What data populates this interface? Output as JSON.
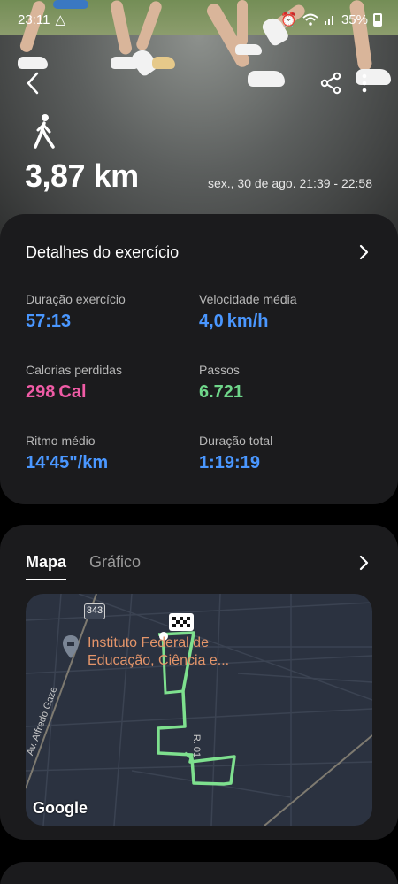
{
  "status_bar": {
    "time": "23:11",
    "battery": "35%"
  },
  "header": {
    "distance": "3,87 km",
    "date_range": "sex., 30 de ago. 21:39 - 22:58"
  },
  "details": {
    "title": "Detalhes do exercício",
    "stats": [
      {
        "label": "Duração exercício",
        "value": "57:13"
      },
      {
        "label": "Velocidade média",
        "value": "4,0 km/h"
      },
      {
        "label": "Calorias perdidas",
        "value": "298 Cal"
      },
      {
        "label": "Passos",
        "value": "6.721"
      },
      {
        "label": "Ritmo médio",
        "value": "14'45\"/km"
      },
      {
        "label": "Duração total",
        "value": "1:19:19"
      }
    ]
  },
  "map_card": {
    "tabs": [
      {
        "label": "Mapa"
      },
      {
        "label": "Gráfico"
      }
    ],
    "map": {
      "road_badge": "343",
      "poi_line1": "Instituto Federal de",
      "poi_line2": "Educação, Ciência e...",
      "street_1": "Av. Alfredo Gaze",
      "street_2": "R. 01",
      "logo": "Google"
    }
  },
  "colors": {
    "accent_blue": "#4a97ff",
    "calories_pink": "#ef5ba5",
    "steps_green": "#6fd68a",
    "route_green": "#7ee08e"
  },
  "icons": [
    "walk-icon",
    "back-arrow-icon",
    "share-icon",
    "more-vert-icon",
    "chevron-right-icon",
    "finish-flag-icon",
    "map-pin-icon"
  ]
}
